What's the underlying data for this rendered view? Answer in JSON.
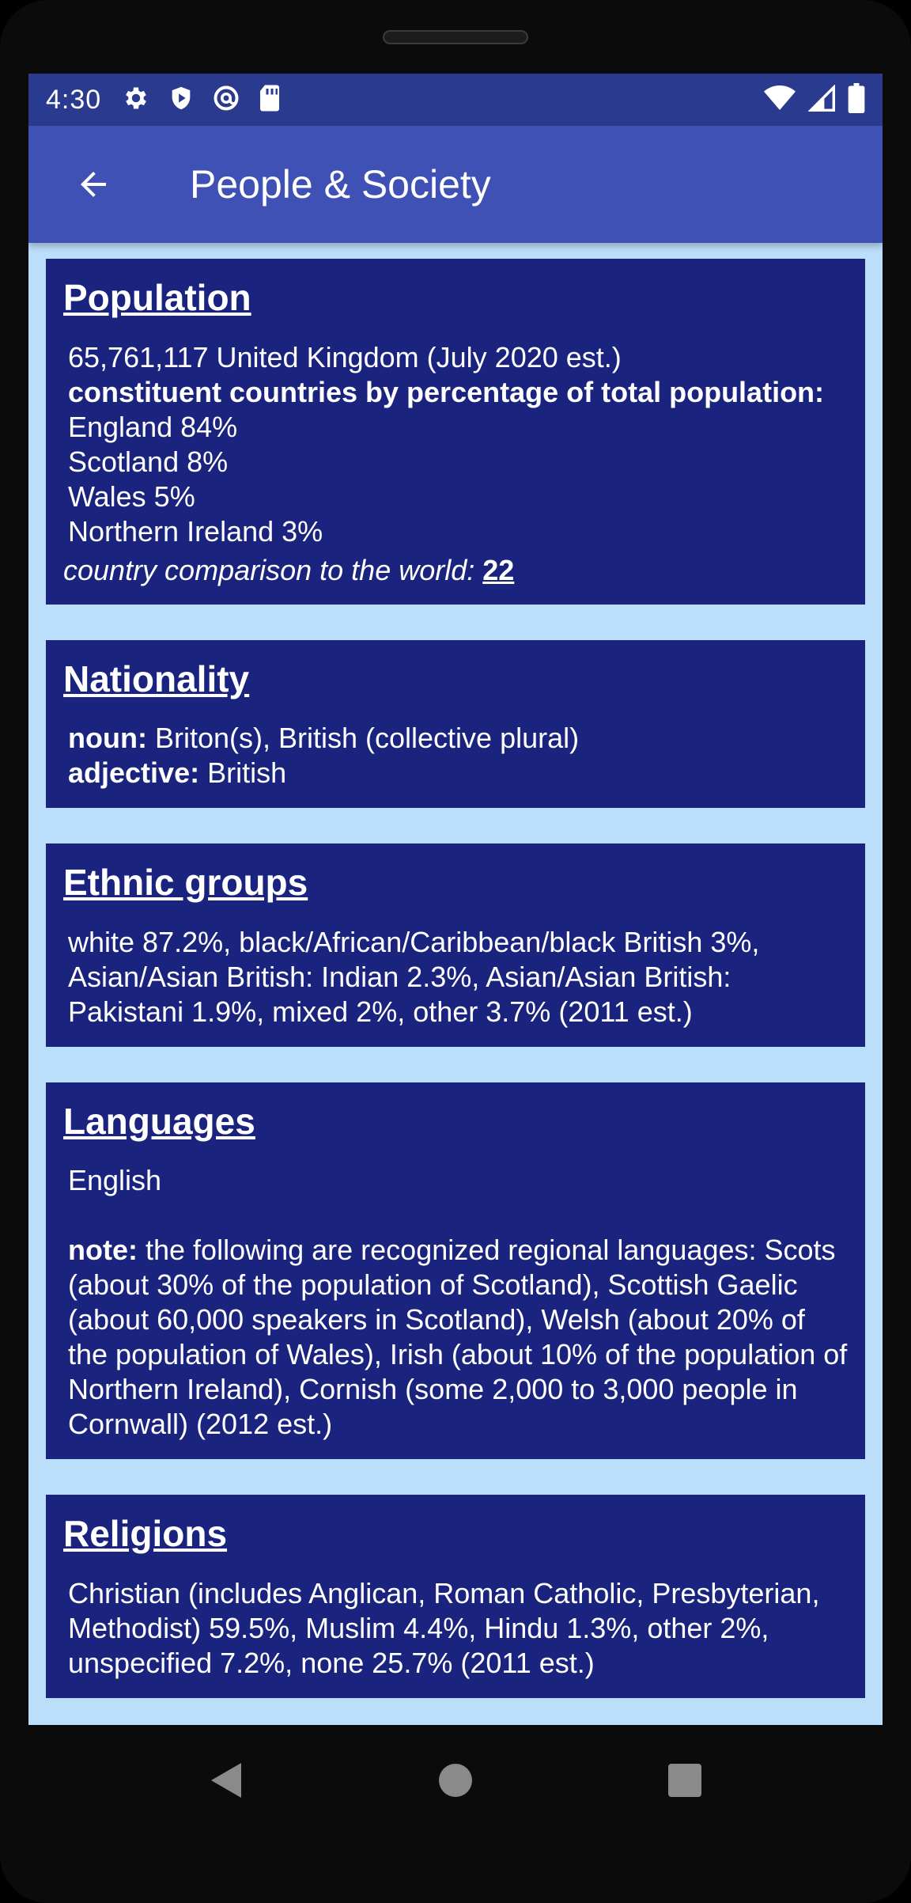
{
  "status_bar": {
    "time": "4:30",
    "left_icons": [
      "gear-icon",
      "shield-play-icon",
      "at-sign-icon",
      "sd-card-icon"
    ],
    "right_icons": [
      "wifi-icon",
      "cell-signal-icon",
      "battery-icon"
    ]
  },
  "app_bar": {
    "title": "People & Society",
    "back_icon": "arrow-left-icon"
  },
  "sections": {
    "population": {
      "title": "Population",
      "line1": "65,761,117 United Kingdom (July 2020 est.)",
      "subheading": "constituent countries by percentage of total population:",
      "items": [
        "England 84%",
        "Scotland 8%",
        "Wales 5%",
        "Northern Ireland 3%"
      ],
      "comparison_label": "country comparison to the world:",
      "comparison_rank": "22"
    },
    "nationality": {
      "title": "Nationality",
      "noun_label": "noun:",
      "noun_value": "Briton(s), British (collective plural)",
      "adjective_label": "adjective:",
      "adjective_value": "British"
    },
    "ethnic_groups": {
      "title": "Ethnic groups",
      "text": "white 87.2%, black/African/Caribbean/black British 3%, Asian/Asian British: Indian 2.3%, Asian/Asian British: Pakistani 1.9%, mixed 2%, other 3.7% (2011 est.)"
    },
    "languages": {
      "title": "Languages",
      "main": "English",
      "note_label": "note:",
      "note_text": "the following are recognized regional languages: Scots (about 30% of the population of Scotland), Scottish Gaelic (about 60,000 speakers in Scotland), Welsh (about 20% of the population of Wales), Irish (about 10% of the population of Northern Ireland), Cornish (some 2,000 to 3,000 people in Cornwall) (2012 est.)"
    },
    "religions": {
      "title": "Religions",
      "text": "Christian (includes Anglican, Roman Catholic, Presbyterian, Methodist) 59.5%, Muslim 4.4%, Hindu 1.3%, other 2%, unspecified 7.2%, none 25.7% (2011 est.)"
    }
  },
  "nav_bar": {
    "icons": [
      "back-triangle-icon",
      "home-circle-icon",
      "recents-square-icon"
    ]
  },
  "colors": {
    "status_bar": "#2a3b8f",
    "app_bar": "#3f51b5",
    "background": "#bbdefb",
    "card": "#1a237e"
  }
}
